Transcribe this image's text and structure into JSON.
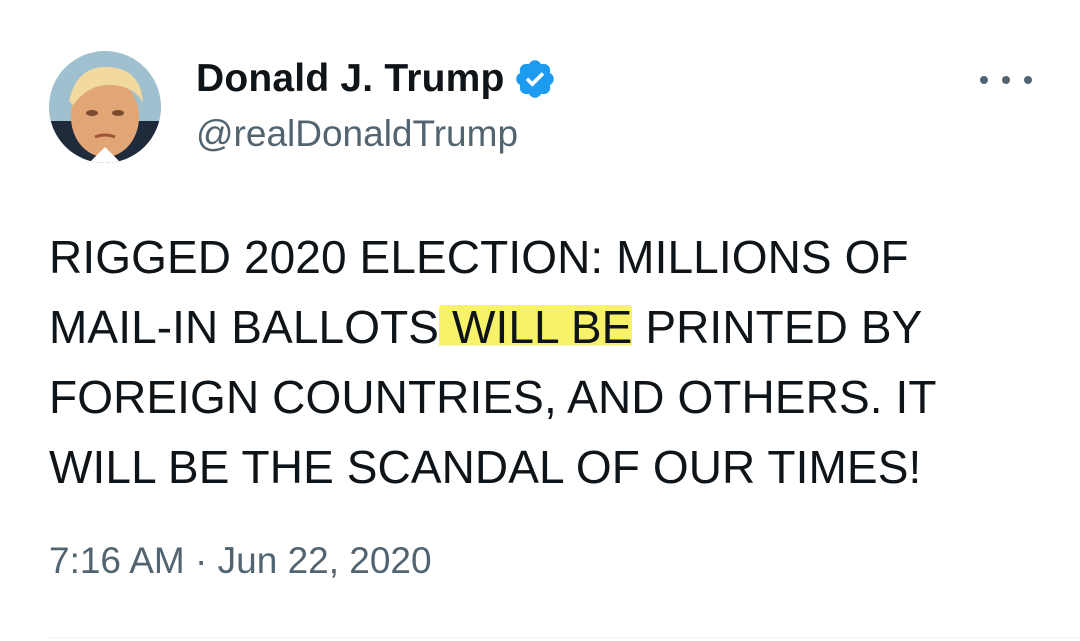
{
  "author": {
    "display_name": "Donald J. Trump",
    "handle": "@realDonaldTrump",
    "verified_icon": "verified-badge-icon",
    "verified_color": "#1d9bf0"
  },
  "tweet": {
    "line1": "RIGGED 2020 ELECTION: MILLIONS OF",
    "line2_before": "MAIL-IN BALLOTS",
    "line2_highlight": " WILL BE",
    "line2_after": " PRINTED BY",
    "line3": "FOREIGN COUNTRIES, AND OTHERS. IT",
    "line4": "WILL BE THE SCANDAL OF OUR TIMES!",
    "highlight_color": "#f6f050"
  },
  "meta": {
    "timestamp": "7:16 AM · Jun 22, 2020"
  },
  "more_menu_icon": "more-horizontal-icon"
}
